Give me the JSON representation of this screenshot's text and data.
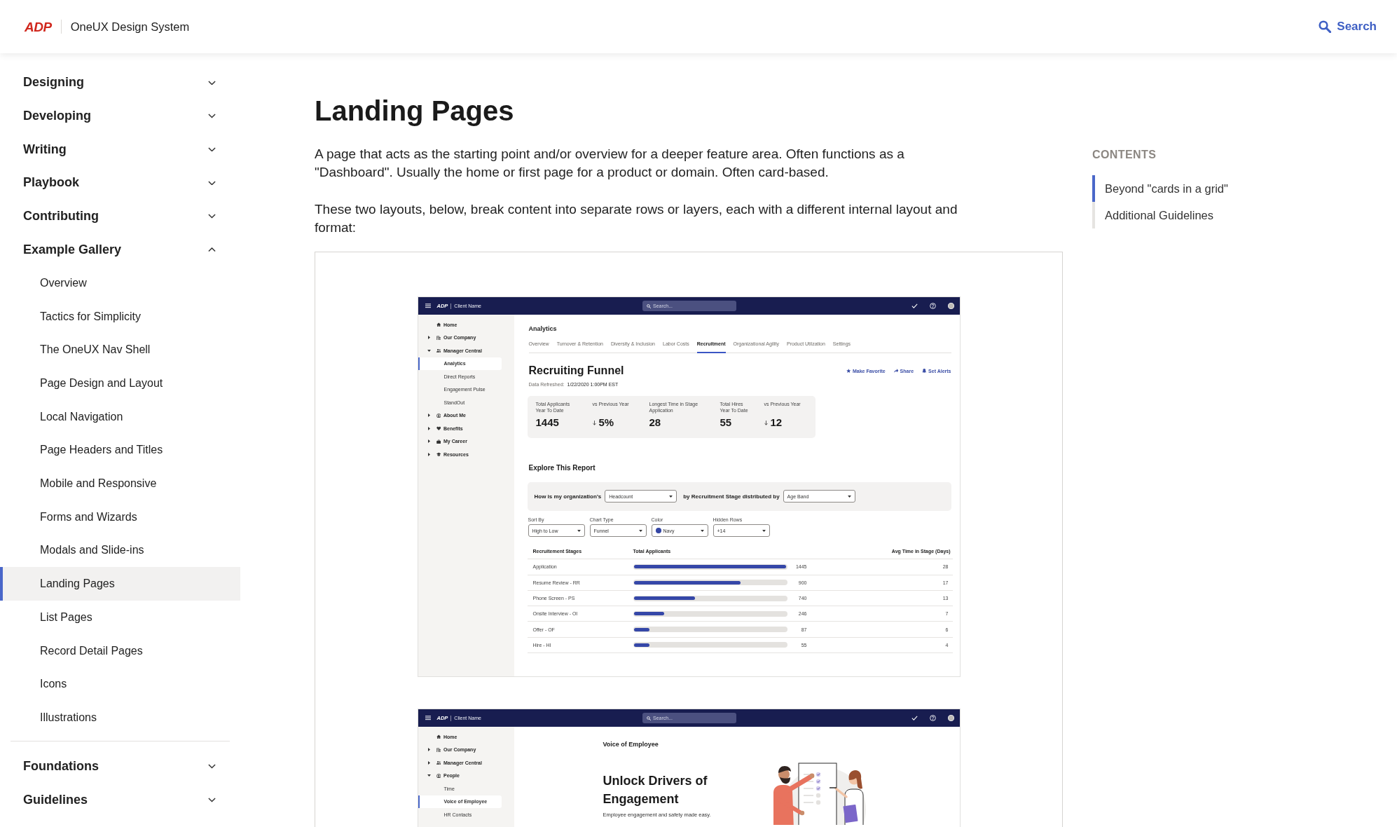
{
  "header": {
    "logo": "ADP",
    "title": "OneUX Design System",
    "search_label": "Search"
  },
  "sidebar": {
    "groups": [
      {
        "sections": [
          {
            "label": "Designing",
            "expanded": false,
            "selected": false
          },
          {
            "label": "Developing",
            "expanded": false,
            "selected": false
          },
          {
            "label": "Writing",
            "expanded": false,
            "selected": false
          },
          {
            "label": "Playbook",
            "expanded": false,
            "selected": false
          },
          {
            "label": "Contributing",
            "expanded": false,
            "selected": false
          },
          {
            "label": "Example Gallery",
            "expanded": true,
            "selected": false,
            "children": [
              {
                "label": "Overview",
                "selected": false
              },
              {
                "label": "Tactics for Simplicity",
                "selected": false
              },
              {
                "label": "The OneUX Nav Shell",
                "selected": false
              },
              {
                "label": "Page Design and Layout",
                "selected": false
              },
              {
                "label": "Local Navigation",
                "selected": false
              },
              {
                "label": "Page Headers and Titles",
                "selected": false
              },
              {
                "label": "Mobile and Responsive",
                "selected": false
              },
              {
                "label": "Forms and Wizards",
                "selected": false
              },
              {
                "label": "Modals and Slide-ins",
                "selected": false
              },
              {
                "label": "Landing Pages",
                "selected": true
              },
              {
                "label": "List Pages",
                "selected": false
              },
              {
                "label": "Record Detail Pages",
                "selected": false
              },
              {
                "label": "Icons",
                "selected": false
              },
              {
                "label": "Illustrations",
                "selected": false
              }
            ]
          }
        ]
      },
      {
        "sections": [
          {
            "label": "Foundations",
            "expanded": false,
            "selected": false
          },
          {
            "label": "Guidelines",
            "expanded": false,
            "selected": false
          }
        ]
      }
    ]
  },
  "page": {
    "title": "Landing Pages",
    "paragraphs": [
      "A page that acts as the starting point and/or overview for a deeper feature area. Often functions as a \"Dashboard\". Usually the home or first page for a product or domain. Often card-based.",
      "These two layouts, below, break content into separate rows or layers, each with a different internal layout and format:"
    ],
    "examples": [
      {
        "kind": "analytics",
        "app_header": {
          "logo": "ADP",
          "client": "Client Name",
          "search_placeholder": "Search..."
        },
        "nav": [
          {
            "label": "Home",
            "selected": false
          },
          {
            "label": "Our Company",
            "expanded": false,
            "selected": false
          },
          {
            "label": "Manager Central",
            "expanded": true,
            "selected": false,
            "children": [
              {
                "label": "Analytics",
                "selected": true
              },
              {
                "label": "Direct Reports",
                "selected": false
              },
              {
                "label": "Engagement Pulse",
                "selected": false
              },
              {
                "label": "StandOut",
                "selected": false
              }
            ]
          },
          {
            "label": "About Me",
            "expanded": false,
            "selected": false
          },
          {
            "label": "Benefits",
            "expanded": false,
            "selected": false
          },
          {
            "label": "My Career",
            "expanded": false,
            "selected": false
          },
          {
            "label": "Resources",
            "expanded": false,
            "selected": false
          }
        ],
        "page_title": "Analytics",
        "tabs": [
          {
            "label": "Overview",
            "selected": false
          },
          {
            "label": "Turnover & Retention",
            "selected": false
          },
          {
            "label": "Diversity & Inclusion",
            "selected": false
          },
          {
            "label": "Labor Costs",
            "selected": false
          },
          {
            "label": "Recruitment",
            "selected": true
          },
          {
            "label": "Organizational Agility",
            "selected": false
          },
          {
            "label": "Product Utilzation",
            "selected": false
          },
          {
            "label": "Settings",
            "selected": false
          }
        ],
        "report_title": "Recruiting Funnel",
        "actions": [
          "Make Favorite",
          "Share",
          "Set Alerts"
        ],
        "refreshed_label": "Data Refreshed:",
        "refreshed_value": "1/22/2020 1:00PM EST",
        "kpis": [
          {
            "label_lines": [
              "Total Applicants",
              "Year To Date"
            ],
            "value": "1445",
            "decrease": false
          },
          {
            "label_lines": [
              "vs Previous Year"
            ],
            "value": "5%",
            "decrease": true
          },
          {
            "label_lines": [
              "Longest Time in Stage",
              "Application"
            ],
            "value": "28",
            "decrease": false
          },
          {
            "label_lines": [
              "Total Hires",
              "Year To Date"
            ],
            "value": "55",
            "decrease": false
          },
          {
            "label_lines": [
              "vs Previous Year"
            ],
            "value": "12",
            "decrease": true
          }
        ],
        "explore_title": "Explore This Report",
        "question": [
          {
            "kind": "text",
            "text": "How is my organization’s"
          },
          {
            "kind": "select",
            "value": "Headcount"
          },
          {
            "kind": "text",
            "text": "by Recruitment Stage distributed by"
          },
          {
            "kind": "select",
            "value": "Age Band"
          }
        ],
        "filters": [
          {
            "label": "Sort By",
            "value": "High to Low"
          },
          {
            "label": "Chart Type",
            "value": "Funnel"
          },
          {
            "label": "Color",
            "value": "Navy",
            "color": "#3446a4"
          },
          {
            "label": "Hidden Rows",
            "value": "+14"
          }
        ],
        "table": {
          "columns": [
            "Recruitement Stages",
            "Total Applicants",
            "Avg Time in Stage (Days)"
          ],
          "rows": [
            {
              "stage": "Application",
              "level": 1,
              "applicants": "1445",
              "avg_days": "28"
            },
            {
              "stage": "Resume Review - RR",
              "level": 0.7,
              "applicants": "900",
              "avg_days": "17"
            },
            {
              "stage": "Phone Screen - PS",
              "level": 0.4,
              "applicants": "740",
              "avg_days": "13"
            },
            {
              "stage": "Onsite Interview - OI",
              "level": 0.2,
              "applicants": "246",
              "avg_days": "7"
            },
            {
              "stage": "Offer - OF",
              "level": 0.1,
              "applicants": "87",
              "avg_days": "6"
            },
            {
              "stage": "Hire - HI",
              "level": 0.1,
              "applicants": "55",
              "avg_days": "4"
            }
          ]
        }
      },
      {
        "kind": "hero",
        "app_header": {
          "logo": "ADP",
          "client": "Client Name",
          "search_placeholder": "Search..."
        },
        "nav": [
          {
            "label": "Home",
            "selected": false
          },
          {
            "label": "Our Company",
            "expanded": false,
            "selected": false
          },
          {
            "label": "Manager Central",
            "expanded": false,
            "selected": false
          },
          {
            "label": "People",
            "expanded": true,
            "selected": false,
            "children": [
              {
                "label": "Time",
                "selected": false
              },
              {
                "label": "Voice of Employee",
                "selected": true
              },
              {
                "label": "HR Contacts",
                "selected": false
              }
            ]
          }
        ],
        "page_title": "Voice of Employee",
        "headline": "Unlock Drivers of Engagement",
        "subtitle": "Employee engagement and safety made easy."
      }
    ]
  },
  "toc": {
    "heading": "CONTENTS",
    "items": [
      {
        "label": "Beyond \"cards in a grid\"",
        "selected": true
      },
      {
        "label": "Additional Guidelines",
        "selected": false
      }
    ]
  }
}
